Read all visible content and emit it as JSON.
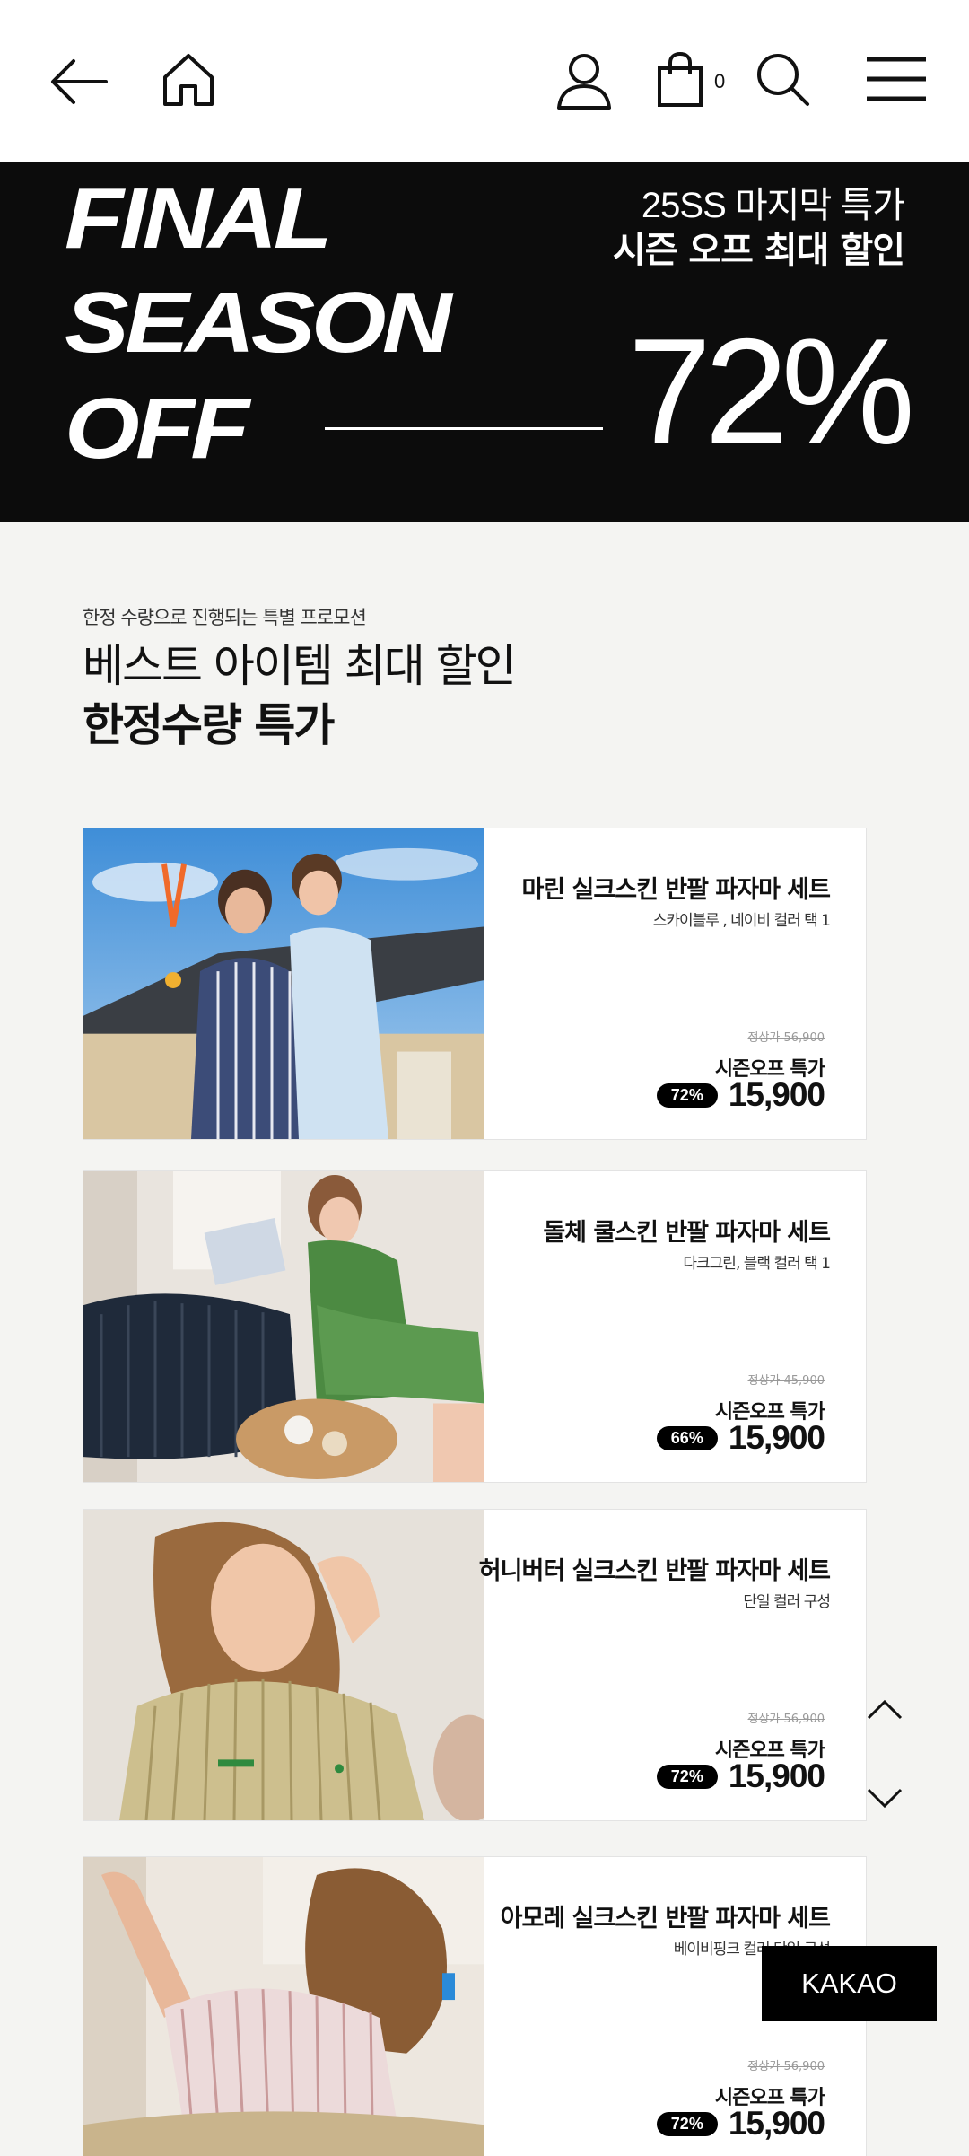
{
  "header": {
    "icons": [
      "back-arrow-icon",
      "home-icon",
      "user-icon",
      "shopping-bag-icon",
      "search-icon",
      "menu-icon"
    ],
    "cart_count": "0"
  },
  "banner": {
    "line1": "FINAL",
    "line2": "SEASON",
    "line3": "OFF",
    "sub1": "25SS 마지막 특가",
    "sub2": "시즌 오프 최대 할인",
    "percent": "72%"
  },
  "intro": {
    "small": "한정 수량으로 진행되는 특별 프로모션",
    "line1": "베스트 아이템 최대 할인",
    "line2": "한정수량 특가"
  },
  "products": [
    {
      "name": "마린 실크스킨 반팔 파자마 세트",
      "options": "스카이블루 , 네이비 컬러 택 1",
      "original": "정상가 56,900",
      "label": "시즌오프 특가",
      "badge": "72%",
      "price": "15,900"
    },
    {
      "name": "돌체 쿨스킨 반팔 파자마 세트",
      "options": "다크그린, 블랙 컬러 택 1",
      "original": "정상가 45,900",
      "label": "시즌오프 특가",
      "badge": "66%",
      "price": "15,900"
    },
    {
      "name": "허니버터 실크스킨 반팔 파자마 세트",
      "options": "단일 컬러 구성",
      "original": "정상가 56,900",
      "label": "시즌오프 특가",
      "badge": "72%",
      "price": "15,900"
    },
    {
      "name": "아모레 실크스킨 반팔 파자마 세트",
      "options": "베이비핑크 컬러 단일 구성",
      "original": "정상가 56,900",
      "label": "시즌오프 특가",
      "badge": "72%",
      "price": "15,900"
    }
  ],
  "floating": {
    "scroll_up_icon": "chevron-up-icon",
    "scroll_down_icon": "chevron-down-icon",
    "kakao_label": "KAKAO"
  }
}
